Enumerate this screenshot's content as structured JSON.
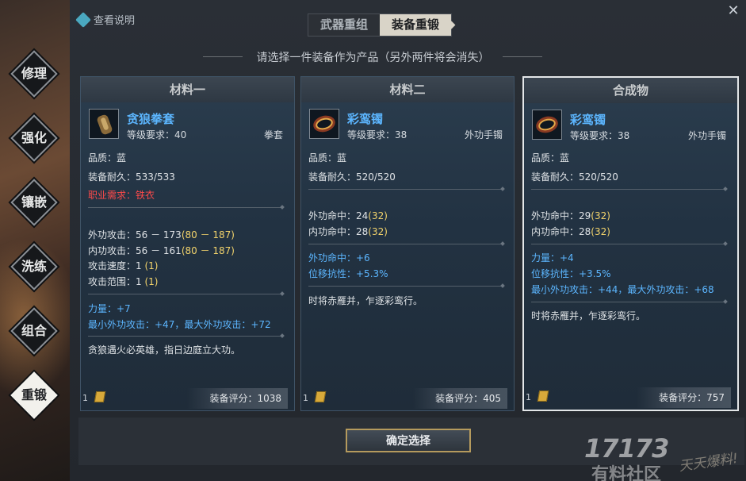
{
  "header": {
    "help_label": "查看说明",
    "close_glyph": "✕",
    "tabs": [
      {
        "label": "武器重组",
        "active": false
      },
      {
        "label": "装备重锻",
        "active": true
      }
    ],
    "instruction": "请选择一件装备作为产品（另外两件将会消失）"
  },
  "nav": [
    {
      "label": "修理",
      "active": false
    },
    {
      "label": "强化",
      "active": false
    },
    {
      "label": "镶嵌",
      "active": false
    },
    {
      "label": "洗练",
      "active": false
    },
    {
      "label": "组合",
      "active": false
    },
    {
      "label": "重锻",
      "active": true
    }
  ],
  "cards": [
    {
      "title": "材料一",
      "item": {
        "name": "贪狼拳套",
        "level": "等级要求：40",
        "type": "拳套",
        "icon": "gauntlet-icon"
      },
      "quality": "品质：蓝",
      "durability": "装备耐久：533/533",
      "requirement": "职业需求：铁衣",
      "stats": [
        {
          "label": "外功攻击：56 － 173",
          "bonus": "(80 － 187)"
        },
        {
          "label": "内功攻击：56 － 161",
          "bonus": "(80 － 187)"
        },
        {
          "label": "攻击速度：1",
          "bonus": "(1)"
        },
        {
          "label": "攻击范围：1",
          "bonus": "(1)"
        }
      ],
      "attrs": [
        "力量：+7",
        "最小外功攻击：+47，最大外功攻击：+72"
      ],
      "desc": "贪狼遇火必英雄，指日边庭立大功。",
      "count": "1",
      "score": "装备评分：1038"
    },
    {
      "title": "材料二",
      "item": {
        "name": "彩鸾镯",
        "level": "等级要求：38",
        "type": "外功手镯",
        "icon": "bracelet-icon"
      },
      "quality": "品质：蓝",
      "durability": "装备耐久：520/520",
      "stats": [
        {
          "label": "外功命中：24",
          "bonus": "(32)"
        },
        {
          "label": "内功命中：28",
          "bonus": "(32)"
        }
      ],
      "attrs": [
        "外功命中：+6",
        "位移抗性：+5.3%"
      ],
      "desc": "时将赤雁并，乍逐彩鸾行。",
      "count": "1",
      "score": "装备评分：405"
    },
    {
      "title": "合成物",
      "item": {
        "name": "彩鸾镯",
        "level": "等级要求：38",
        "type": "外功手镯",
        "icon": "bracelet-icon"
      },
      "quality": "品质：蓝",
      "durability": "装备耐久：520/520",
      "stats": [
        {
          "label": "外功命中：29",
          "bonus": "(32)"
        },
        {
          "label": "内功命中：28",
          "bonus": "(32)"
        }
      ],
      "attrs": [
        "力量：+4",
        "位移抗性：+3.5%",
        "最小外功攻击：+44，最大外功攻击：+68"
      ],
      "desc": "时将赤雁并，乍逐彩鸾行。",
      "count": "1",
      "score": "装备评分：757"
    }
  ],
  "confirm_label": "确定选择",
  "watermark": {
    "brand": "17173",
    "sub": "有料社区",
    "slogan": "天天爆料!"
  },
  "colors": {
    "quality_blue": "#5cb6ff",
    "requirement_red": "#ff4a4a",
    "bonus_yellow": "#f2d36b",
    "confirm_border": "#b59a5d"
  }
}
